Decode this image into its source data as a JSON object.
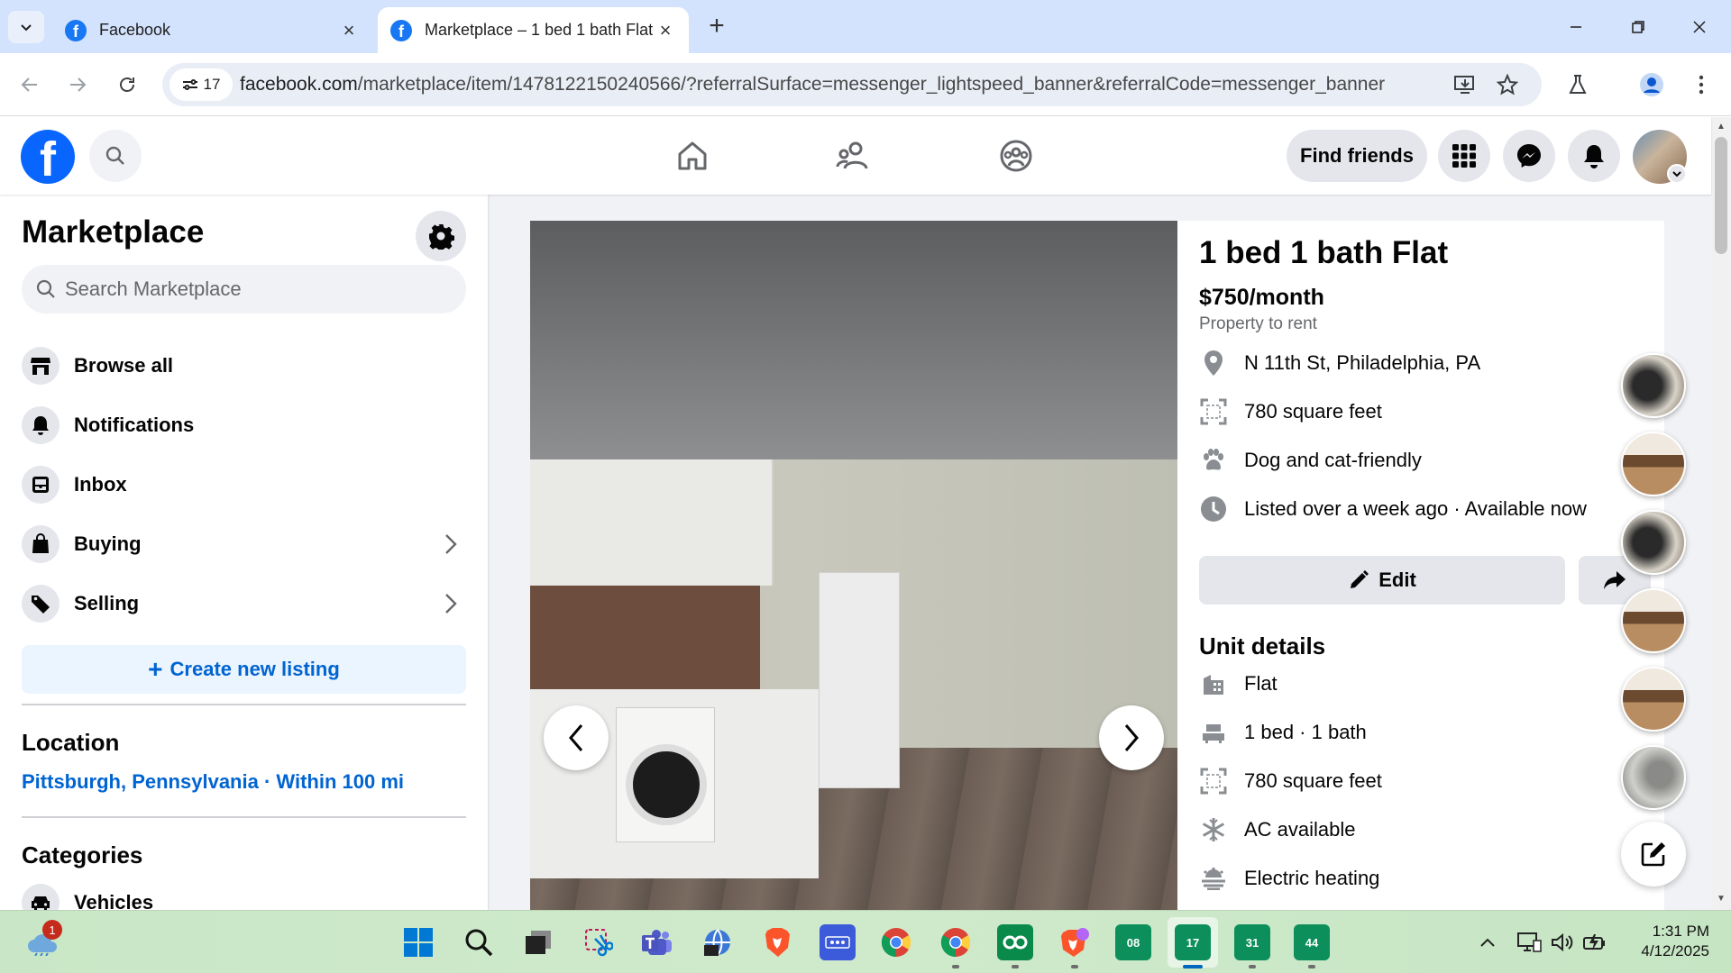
{
  "browser": {
    "tabs": [
      {
        "title": "Facebook",
        "active": false
      },
      {
        "title": "Marketplace – 1 bed 1 bath Flat",
        "active": true
      }
    ],
    "site_chip_count": "17",
    "url_host": "facebook.com",
    "url_rest": "/marketplace/item/1478122150240566/?referralSurface=messenger_lightspeed_banner&referralCode=messenger_banner"
  },
  "header": {
    "find_friends_label": "Find friends"
  },
  "sidebar": {
    "title": "Marketplace",
    "search_placeholder": "Search Marketplace",
    "items": [
      {
        "label": "Browse all",
        "icon": "storefront-icon"
      },
      {
        "label": "Notifications",
        "icon": "bell-icon"
      },
      {
        "label": "Inbox",
        "icon": "inbox-icon"
      },
      {
        "label": "Buying",
        "icon": "shopping-bag-icon"
      },
      {
        "label": "Selling",
        "icon": "tag-icon"
      }
    ],
    "create_label": "Create new listing",
    "location_heading": "Location",
    "location_value": "Pittsburgh, Pennsylvania · Within 100 mi",
    "categories_heading": "Categories",
    "first_category": "Vehicles"
  },
  "listing": {
    "title": "1 bed 1 bath Flat",
    "price": "$750/month",
    "property_type": "Property to rent",
    "details": [
      {
        "text": "N 11th St, Philadelphia, PA",
        "icon": "location-pin-icon"
      },
      {
        "text": "780 square feet",
        "icon": "area-icon"
      },
      {
        "text": "Dog and cat-friendly",
        "icon": "paw-icon"
      },
      {
        "text": "Listed over a week ago · Available now",
        "icon": "clock-icon"
      }
    ],
    "edit_label": "Edit",
    "unit_details_heading": "Unit details",
    "unit_details": [
      {
        "text": "Flat",
        "icon": "building-icon"
      },
      {
        "text": "1 bed · 1 bath",
        "icon": "bed-icon"
      },
      {
        "text": "780 square feet",
        "icon": "area-icon"
      },
      {
        "text": "AC available",
        "icon": "snowflake-icon"
      },
      {
        "text": "Electric heating",
        "icon": "heating-icon"
      }
    ]
  },
  "taskbar": {
    "weather_badge": "1",
    "calendar_apps": [
      "08",
      "17",
      "31",
      "44"
    ],
    "time": "1:31 PM",
    "date": "4/12/2025"
  },
  "colors": {
    "facebook_blue": "#0866ff",
    "link_blue": "#0064d1",
    "tab_strip": "#d3e3fd"
  }
}
